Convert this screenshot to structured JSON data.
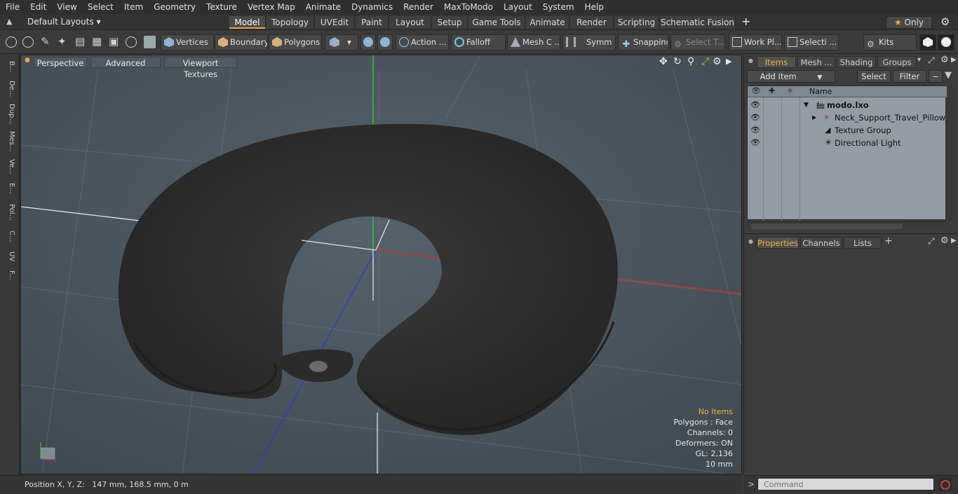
{
  "menu": [
    "File",
    "Edit",
    "View",
    "Select",
    "Item",
    "Geometry",
    "Texture",
    "Vertex Map",
    "Animate",
    "Dynamics",
    "Render",
    "MaxToModo",
    "Layout",
    "System",
    "Help"
  ],
  "layout": {
    "preset": "Default Layouts",
    "tabs": [
      "Model",
      "Topology",
      "UVEdit",
      "Paint",
      "Layout",
      "Setup",
      "Game Tools",
      "Animate",
      "Render",
      "Scripting",
      "Schematic Fusion"
    ],
    "active_tab": "Model",
    "add_tab": "+",
    "only_label": "Only"
  },
  "toolbar": {
    "vertices": "Vertices",
    "boundary": "Boundary",
    "polygons": "Polygons",
    "action": "Action",
    "falloff": "Falloff",
    "mesh_c": "Mesh C ...",
    "symm": "Symm ...",
    "snapping": "Snapping",
    "select_t": "Select T...",
    "work_pl": "Work Pl...",
    "selecti": "Selecti ...",
    "kits": "Kits"
  },
  "left_strip": [
    "B...",
    "De...",
    "Dup...",
    "Mes...",
    "Ve...",
    "E...",
    "Pol...",
    "C...",
    "UV",
    "F..."
  ],
  "viewport": {
    "perspective": "Perspective",
    "advanced": "Advanced",
    "textures": "Viewport Textures",
    "info": {
      "items": "No Items",
      "polygons": "Polygons : Face",
      "channels": "Channels: 0",
      "deformers": "Deformers: ON",
      "gl": "GL: 2,136",
      "scale": "10 mm"
    }
  },
  "status": {
    "position": "Position X, Y, Z:   147 mm, 168.5 mm, 0 m"
  },
  "items_panel": {
    "tabs": [
      "Items",
      "Mesh ...",
      "Shading",
      "Groups"
    ],
    "active_tab": "Items",
    "add_item": "Add Item",
    "select": "Select",
    "filter": "Filter",
    "name_header": "Name",
    "rows": [
      {
        "label": "modo.lxo",
        "bold": true
      },
      {
        "label": "Neck_Support_Travel_Pillow_..."
      },
      {
        "label": "Texture Group"
      },
      {
        "label": "Directional Light"
      }
    ]
  },
  "props_panel": {
    "tabs": [
      "Properties",
      "Channels",
      "Lists"
    ],
    "active_tab": "Properties",
    "add_tab": "+"
  },
  "command": {
    "placeholder": "Command",
    "prompt": ">"
  },
  "colors": {
    "accent": "#e6a63a",
    "viewport_bg": "#46515a",
    "list_bg": "#939ca5"
  }
}
